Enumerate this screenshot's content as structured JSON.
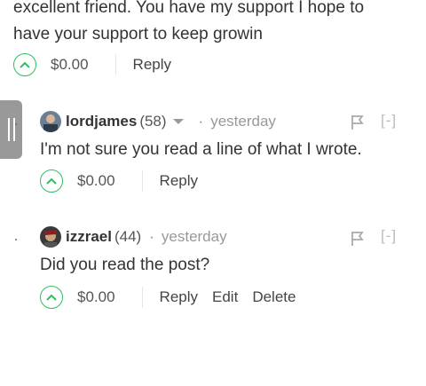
{
  "parent_comment": {
    "body_lines": [
      "excellent friend. You have my support I hope to",
      "have your support to keep growin"
    ],
    "payout": "$0.00",
    "reply_label": "Reply"
  },
  "replies": [
    {
      "author": "lordjames",
      "reputation": "(58)",
      "separator": "·",
      "time": "yesterday",
      "collapse_label": "[-]",
      "body": "I'm not sure you read a line of what I wrote.",
      "payout": "$0.00",
      "reply_label": "Reply"
    },
    {
      "author": "izzrael",
      "reputation": "(44)",
      "separator": "·",
      "time": "yesterday",
      "collapse_label": "[-]",
      "body": "Did you read the post?",
      "payout": "$0.00",
      "reply_label": "Reply",
      "edit_label": "Edit",
      "delete_label": "Delete"
    }
  ],
  "colors": {
    "upvote": "#2fbf5f",
    "muted": "#999999",
    "text": "#333333",
    "handle": "#999999"
  },
  "icons": [
    "upvote-chevron-icon",
    "flag-icon",
    "caret-down-icon",
    "drag-handle-icon"
  ]
}
